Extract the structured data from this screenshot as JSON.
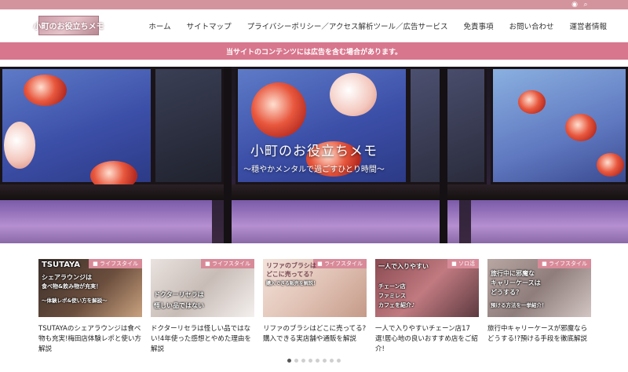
{
  "topbar": {
    "icons": [
      "rss-icon",
      "search-icon"
    ]
  },
  "header": {
    "logo_text": "小町のお役立ちメモ",
    "nav": [
      "ホーム",
      "サイトマップ",
      "プライバシーポリシー／アクセス解析ツール／広告サービス",
      "免責事項",
      "お問い合わせ",
      "運営者情報"
    ]
  },
  "notice": {
    "text": "当サイトのコンテンツには広告を含む場合があります。"
  },
  "hero": {
    "title": "小町のお役立ちメモ",
    "subtitle": "〜穏やかメンタルで過ごすひとり時間〜"
  },
  "cards": [
    {
      "category": "ライフスタイル",
      "thumb_lines": [
        "TSUTAYA",
        "シェアラウンジは",
        "食べ物&飲み物が充実！",
        "〜体験レポ&使い方を解説〜"
      ],
      "title": "TSUTAYAのシェアラウンジは食べ物も充実!梅田店体験レポと使い方解説"
    },
    {
      "category": "ライフスタイル",
      "thumb_lines": [
        "ドクターリセラは",
        "怪しい品ではない"
      ],
      "title": "ドクターリセラは怪しい品ではない!4年使った感想とやめた理由を解説"
    },
    {
      "category": "ライフスタイル",
      "thumb_lines": [
        "リファのブラシは",
        "どこに売ってる？",
        "購入できる販売を解説！"
      ],
      "title": "リファのブラシはどこに売ってる?購入できる実店舗や通販を解説"
    },
    {
      "category": "ソロ活",
      "thumb_lines": [
        "一人で入りやすい",
        "チェーン店",
        "ファミレス",
        "カフェを紹介♪"
      ],
      "title": "一人で入りやすいチェーン店17選!居心地の良いおすすめ店をご紹介!"
    },
    {
      "category": "ライフスタイル",
      "thumb_lines": [
        "旅行中に邪魔な",
        "キャリーケースは",
        "どうする？",
        "預ける方法を一挙紹介！"
      ],
      "title": "旅行中キャリーケースが邪魔ならどうする!?預ける手段を徹底解説"
    }
  ],
  "carousel": {
    "dot_count": 8,
    "active_index": 0
  },
  "colors": {
    "topbar": "#d4949d",
    "notice": "#d8768d",
    "badge": "#d88a99"
  }
}
